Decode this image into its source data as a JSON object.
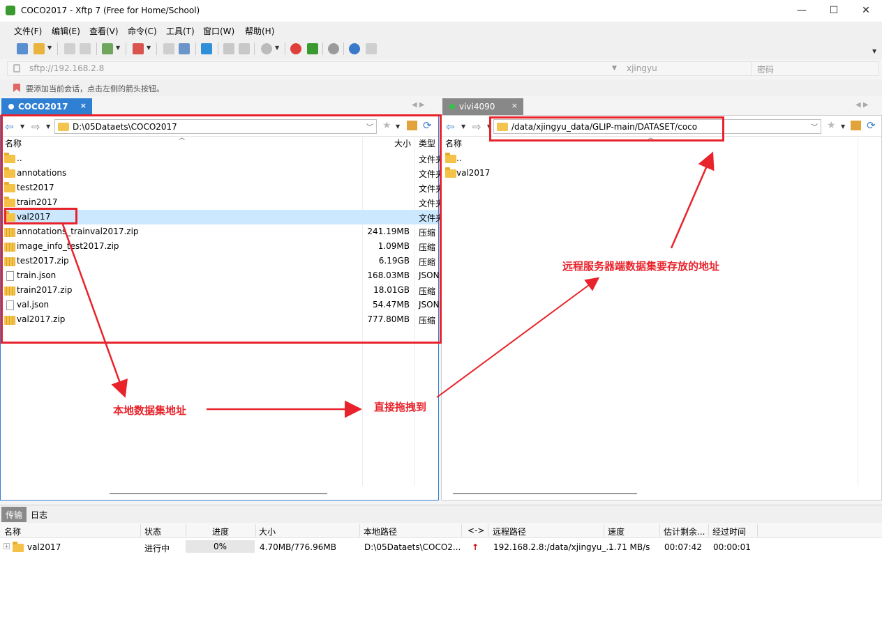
{
  "window": {
    "title": "COCO2017 - Xftp 7 (Free for Home/School)",
    "minimize": "—",
    "maximize": "☐",
    "close": "✕"
  },
  "menu": [
    "文件(F)",
    "编辑(E)",
    "查看(V)",
    "命令(C)",
    "工具(T)",
    "窗口(W)",
    "帮助(H)"
  ],
  "address": {
    "host": "sftp://192.168.2.8",
    "user": "xjingyu",
    "password_placeholder": "密码"
  },
  "hint": "要添加当前会话，点击左侧的箭头按钮。",
  "tabs": {
    "left": {
      "label": "COCO2017",
      "close": "×"
    },
    "right": {
      "label": "vivi4090",
      "close": "×"
    },
    "nav": "◀  ▶"
  },
  "left_panel": {
    "path": "D:\\05Dataets\\COCO2017",
    "columns": {
      "name": "名称",
      "size": "大小",
      "type": "类型"
    },
    "rows": [
      {
        "name": "..",
        "size": "",
        "type": "文件夹",
        "icon": "folder"
      },
      {
        "name": "annotations",
        "size": "",
        "type": "文件夹",
        "icon": "folder"
      },
      {
        "name": "test2017",
        "size": "",
        "type": "文件夹",
        "icon": "folder"
      },
      {
        "name": "train2017",
        "size": "",
        "type": "文件夹",
        "icon": "folder"
      },
      {
        "name": "val2017",
        "size": "",
        "type": "文件夹",
        "icon": "folder"
      },
      {
        "name": "annotations_trainval2017.zip",
        "size": "241.19MB",
        "type": "压缩",
        "icon": "zip"
      },
      {
        "name": "image_info_test2017.zip",
        "size": "1.09MB",
        "type": "压缩",
        "icon": "zip"
      },
      {
        "name": "test2017.zip",
        "size": "6.19GB",
        "type": "压缩",
        "icon": "zip"
      },
      {
        "name": "train.json",
        "size": "168.03MB",
        "type": "JSON",
        "icon": "doc"
      },
      {
        "name": "train2017.zip",
        "size": "18.01GB",
        "type": "压缩",
        "icon": "zip"
      },
      {
        "name": "val.json",
        "size": "54.47MB",
        "type": "JSON",
        "icon": "doc"
      },
      {
        "name": "val2017.zip",
        "size": "777.80MB",
        "type": "压缩",
        "icon": "zip"
      }
    ]
  },
  "right_panel": {
    "path": "/data/xjingyu_data/GLIP-main/DATASET/coco",
    "columns": {
      "name": "名称"
    },
    "rows": [
      {
        "name": "..",
        "icon": "folder"
      },
      {
        "name": "val2017",
        "icon": "folder"
      }
    ]
  },
  "annotations": {
    "local": "本地数据集地址",
    "drag": "直接拖拽到",
    "remote": "远程服务器端数据集要存放的地址",
    "color": "#e8232b"
  },
  "bottom": {
    "tabs": [
      "传输",
      "日志"
    ],
    "headers": [
      "名称",
      "状态",
      "进度",
      "大小",
      "本地路径",
      "<->",
      "远程路径",
      "速度",
      "估计剩余...",
      "经过时间"
    ],
    "transfer": {
      "name": "val2017",
      "status": "进行中",
      "progress": "0%",
      "progress_fraction": 0.0,
      "size": "4.70MB/776.96MB",
      "local_path": "D:\\05Dataets\\COCO2...",
      "direction": "↑",
      "remote_path": "192.168.2.8:/data/xjingyu_...",
      "speed": "1.71 MB/s",
      "remaining": "00:07:42",
      "elapsed": "00:00:01"
    }
  }
}
